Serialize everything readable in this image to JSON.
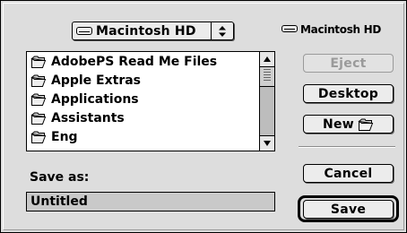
{
  "location_popup": {
    "label": "Macintosh HD",
    "icon": "hard-disk-icon",
    "arrows": "updown-arrows-icon"
  },
  "disk": {
    "name": "Macintosh HD",
    "icon": "hard-disk-icon"
  },
  "file_list": {
    "items": [
      {
        "label": "AdobePS Read Me Files",
        "icon": "folder-icon"
      },
      {
        "label": "Apple Extras",
        "icon": "folder-icon"
      },
      {
        "label": "Applications",
        "icon": "folder-icon"
      },
      {
        "label": "Assistants",
        "icon": "folder-icon"
      },
      {
        "label": "Eng",
        "icon": "folder-icon"
      }
    ]
  },
  "buttons": {
    "eject": "Eject",
    "desktop": "Desktop",
    "new": "New",
    "cancel": "Cancel",
    "save": "Save"
  },
  "save_as": {
    "label": "Save as:",
    "value": "Untitled"
  }
}
